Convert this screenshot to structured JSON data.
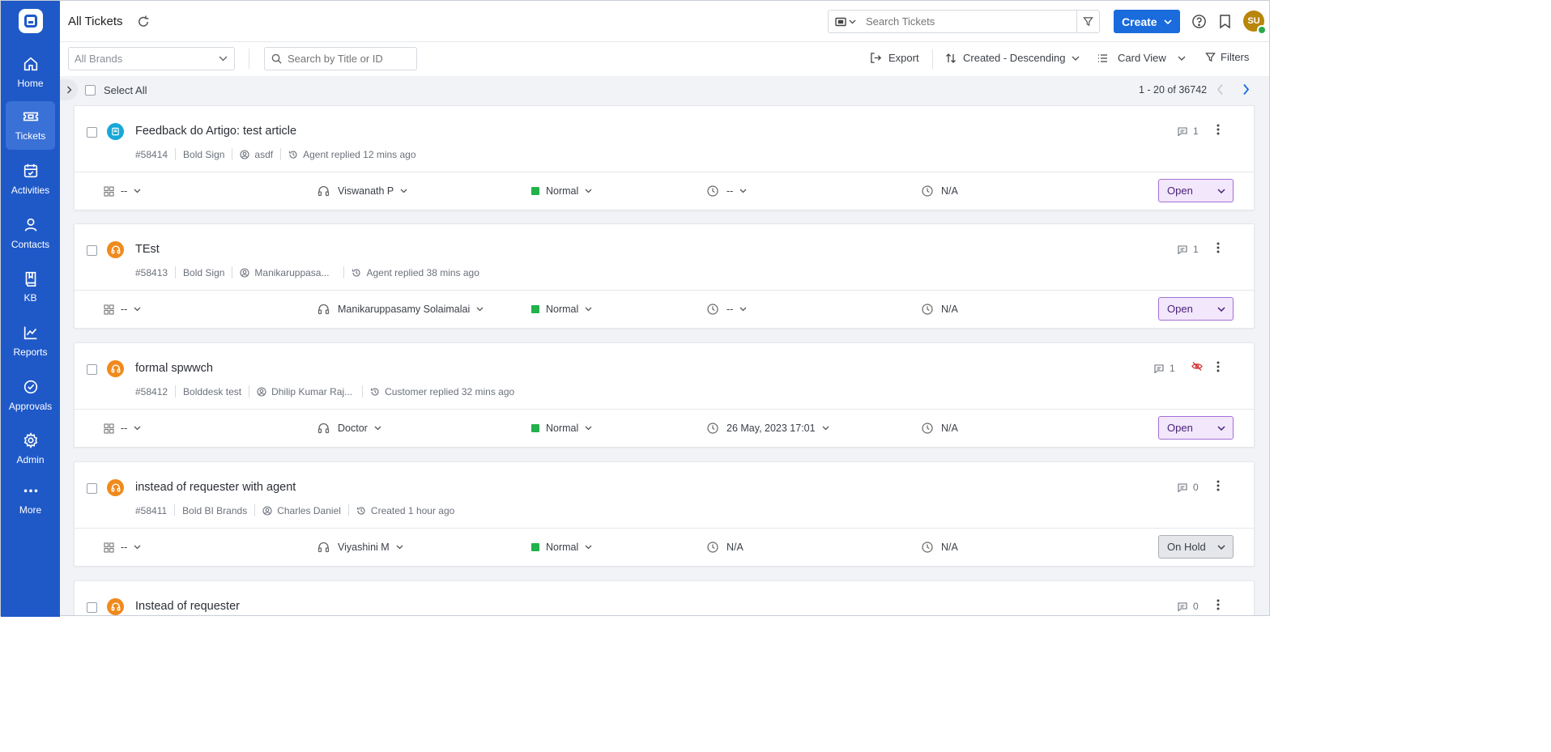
{
  "sidebar": {
    "items": [
      {
        "label": "Home",
        "icon": "home-icon"
      },
      {
        "label": "Tickets",
        "icon": "ticket-icon",
        "active": true
      },
      {
        "label": "Activities",
        "icon": "calendar-icon"
      },
      {
        "label": "Contacts",
        "icon": "contact-icon"
      },
      {
        "label": "KB",
        "icon": "book-icon"
      },
      {
        "label": "Reports",
        "icon": "reports-icon"
      },
      {
        "label": "Approvals",
        "icon": "approval-icon"
      },
      {
        "label": "Admin",
        "icon": "gear-icon"
      },
      {
        "label": "More",
        "icon": "more-icon"
      }
    ]
  },
  "header": {
    "title": "All Tickets",
    "search_placeholder": "Search Tickets",
    "create_label": "Create",
    "avatar_initials": "SU"
  },
  "toolbar": {
    "brands_placeholder": "All Brands",
    "title_search_placeholder": "Search by Title or ID",
    "export_label": "Export",
    "sort_label": "Created - Descending",
    "view_label": "Card View",
    "filters_label": "Filters"
  },
  "selection": {
    "select_all_label": "Select All",
    "pager_text": "1 - 20 of 36742"
  },
  "colors": {
    "sidebar": "#1f59c8",
    "accent": "#1a6bdc",
    "priority_normal": "#22b14c",
    "ticket_icon_kb": "#18a8d8",
    "ticket_icon_support": "#f08a1c",
    "status_open_bg": "#f2e7fb",
    "status_hold_bg": "#e4e6ea"
  },
  "tickets": [
    {
      "title": "Feedback do Artigo: test article",
      "source_icon": "kb-article-icon",
      "id": "#58414",
      "brand": "Bold Sign",
      "contact": "asdf",
      "activity": "Agent replied 12 mins ago",
      "comments": "1",
      "category": "--",
      "agent": "Viswanath P",
      "priority": "Normal",
      "due": "--",
      "sla": "N/A",
      "status": "Open"
    },
    {
      "title": "TEst",
      "source_icon": "headset-icon",
      "id": "#58413",
      "brand": "Bold Sign",
      "contact": "Manikaruppasa...",
      "activity": "Agent replied 38 mins ago",
      "comments": "1",
      "category": "--",
      "agent": "Manikaruppasamy Solaimalai",
      "priority": "Normal",
      "due": "--",
      "sla": "N/A",
      "status": "Open"
    },
    {
      "title": "formal spwwch",
      "source_icon": "headset-icon",
      "id": "#58412",
      "brand": "Bolddesk test",
      "contact": "Dhilip Kumar Raj...",
      "activity": "Customer replied 32 mins ago",
      "comments": "1",
      "category": "--",
      "agent": "Doctor",
      "priority": "Normal",
      "due": "26 May, 2023 17:01",
      "sla": "N/A",
      "status": "Open"
    },
    {
      "title": "instead of requester with agent",
      "source_icon": "headset-icon",
      "id": "#58411",
      "brand": "Bold BI Brands",
      "contact": "Charles Daniel",
      "activity": "Created 1 hour ago",
      "comments": "0",
      "category": "--",
      "agent": "Viyashini M",
      "priority": "Normal",
      "due": "N/A",
      "sla": "N/A",
      "status": "On Hold"
    },
    {
      "title": "Instead of requester",
      "source_icon": "headset-icon",
      "comments": "0"
    }
  ]
}
